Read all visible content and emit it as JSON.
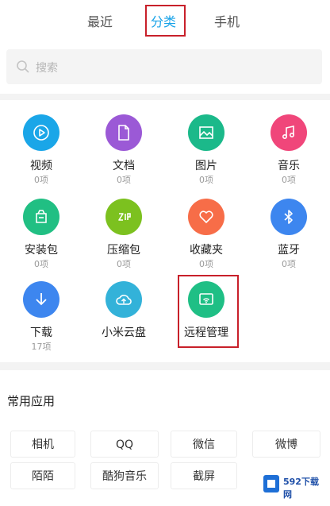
{
  "tabs": [
    {
      "label": "最近",
      "active": false
    },
    {
      "label": "分类",
      "active": true
    },
    {
      "label": "手机",
      "active": false
    }
  ],
  "search": {
    "placeholder": "搜索"
  },
  "categories": [
    {
      "name": "视频",
      "count": "0项",
      "icon": "play-icon",
      "color": "#1aa6e8"
    },
    {
      "name": "文档",
      "count": "0项",
      "icon": "document-icon",
      "color": "#9b59d6"
    },
    {
      "name": "图片",
      "count": "0项",
      "icon": "image-icon",
      "color": "#1bb98a"
    },
    {
      "name": "音乐",
      "count": "0项",
      "icon": "music-icon",
      "color": "#f0467a"
    },
    {
      "name": "安装包",
      "count": "0项",
      "icon": "package-icon",
      "color": "#21bf83"
    },
    {
      "name": "压缩包",
      "count": "0项",
      "icon": "zip-icon",
      "color": "#7cc11f"
    },
    {
      "name": "收藏夹",
      "count": "0项",
      "icon": "heart-icon",
      "color": "#f76d48"
    },
    {
      "name": "蓝牙",
      "count": "0项",
      "icon": "bluetooth-icon",
      "color": "#3d86ef"
    },
    {
      "name": "下载",
      "count": "17项",
      "icon": "download-icon",
      "color": "#3d86ef"
    },
    {
      "name": "小米云盘",
      "count": "",
      "icon": "cloud-icon",
      "color": "#33b2d9"
    },
    {
      "name": "远程管理",
      "count": "",
      "icon": "remote-manage-icon",
      "color": "#1fbf85"
    }
  ],
  "common_apps": {
    "title": "常用应用",
    "items": [
      "相机",
      "QQ",
      "微信",
      "微博",
      "陌陌",
      "酷狗音乐",
      "截屏"
    ]
  },
  "watermark": {
    "text": "592下载网"
  },
  "colors": {
    "accent": "#19a3e8",
    "highlight_box": "#c8202a"
  }
}
